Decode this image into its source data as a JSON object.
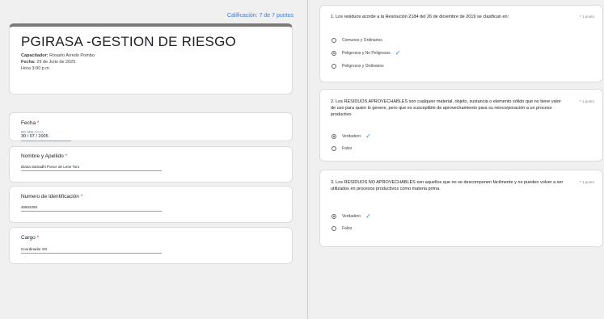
{
  "left": {
    "score": "Calificación: 7 de 7 puntos",
    "header": {
      "title": "PGIRASA -GESTION DE RIESGO",
      "capacitador_label": "Capacitador:",
      "capacitador_value": "Rosario Arredo Pombo",
      "fecha_label": "Fecha:",
      "fecha_value": "29 de Julio de 2025",
      "hora": "Hora 3:00 p.m"
    },
    "fields": [
      {
        "label": "Fecha",
        "required": "*",
        "hint": "DD  MM  AAAA",
        "value": "30 / 07 / 2005"
      },
      {
        "label": "Nombre y Apellido",
        "required": "*",
        "value": "Diana Samadhi Ponce de León Toro"
      },
      {
        "label": "Numero de Identificación",
        "required": "*",
        "value": "45502293"
      },
      {
        "label": "Cargo",
        "required": "*",
        "value": "Coordinador SG"
      }
    ]
  },
  "right": {
    "questions": [
      {
        "text": "1. Los residuos acorde a la Resolución 2184 del 26 de diciembre de 2019 se clasifican en:",
        "required": "*",
        "points": "1 punto",
        "options": [
          {
            "label": "Comunes y Ordinarios",
            "selected": false,
            "correct": false
          },
          {
            "label": "Peligrosos y No Peligrosos",
            "selected": true,
            "correct": true
          },
          {
            "label": "Peligrosos y Ordinarios",
            "selected": false,
            "correct": false
          }
        ]
      },
      {
        "text": "2. Los RESIDUOS APROVECHABLES son cualquier material, objeto, sustancia o elemento sólido que no tiene valor de uso para quien lo genere, pero que es susceptible de aprovechamiento para su reincorporación a un proceso productivo",
        "required": "*",
        "points": "1 punto",
        "options": [
          {
            "label": "Verdadero",
            "selected": true,
            "correct": true
          },
          {
            "label": "Falso",
            "selected": false,
            "correct": false
          }
        ]
      },
      {
        "text": "3. Los RESIDUOS NO APROVECHABLES son aquellos que no se descomponen fácilmente y no pueden volver a ser utilizados en procesos productivos como materia prima.",
        "required": "*",
        "points": "1 punto",
        "options": [
          {
            "label": "Verdadero",
            "selected": true,
            "correct": true
          },
          {
            "label": "Falso",
            "selected": false,
            "correct": false
          }
        ]
      }
    ]
  },
  "colors": {
    "accent": "#3c78d8",
    "required": "#d93025",
    "header_bar": "#7a7a7a"
  },
  "icons": {
    "selected_radio": "radio-checked-icon",
    "unselected_radio": "radio-unchecked-icon",
    "correct": "checkmark-icon"
  }
}
